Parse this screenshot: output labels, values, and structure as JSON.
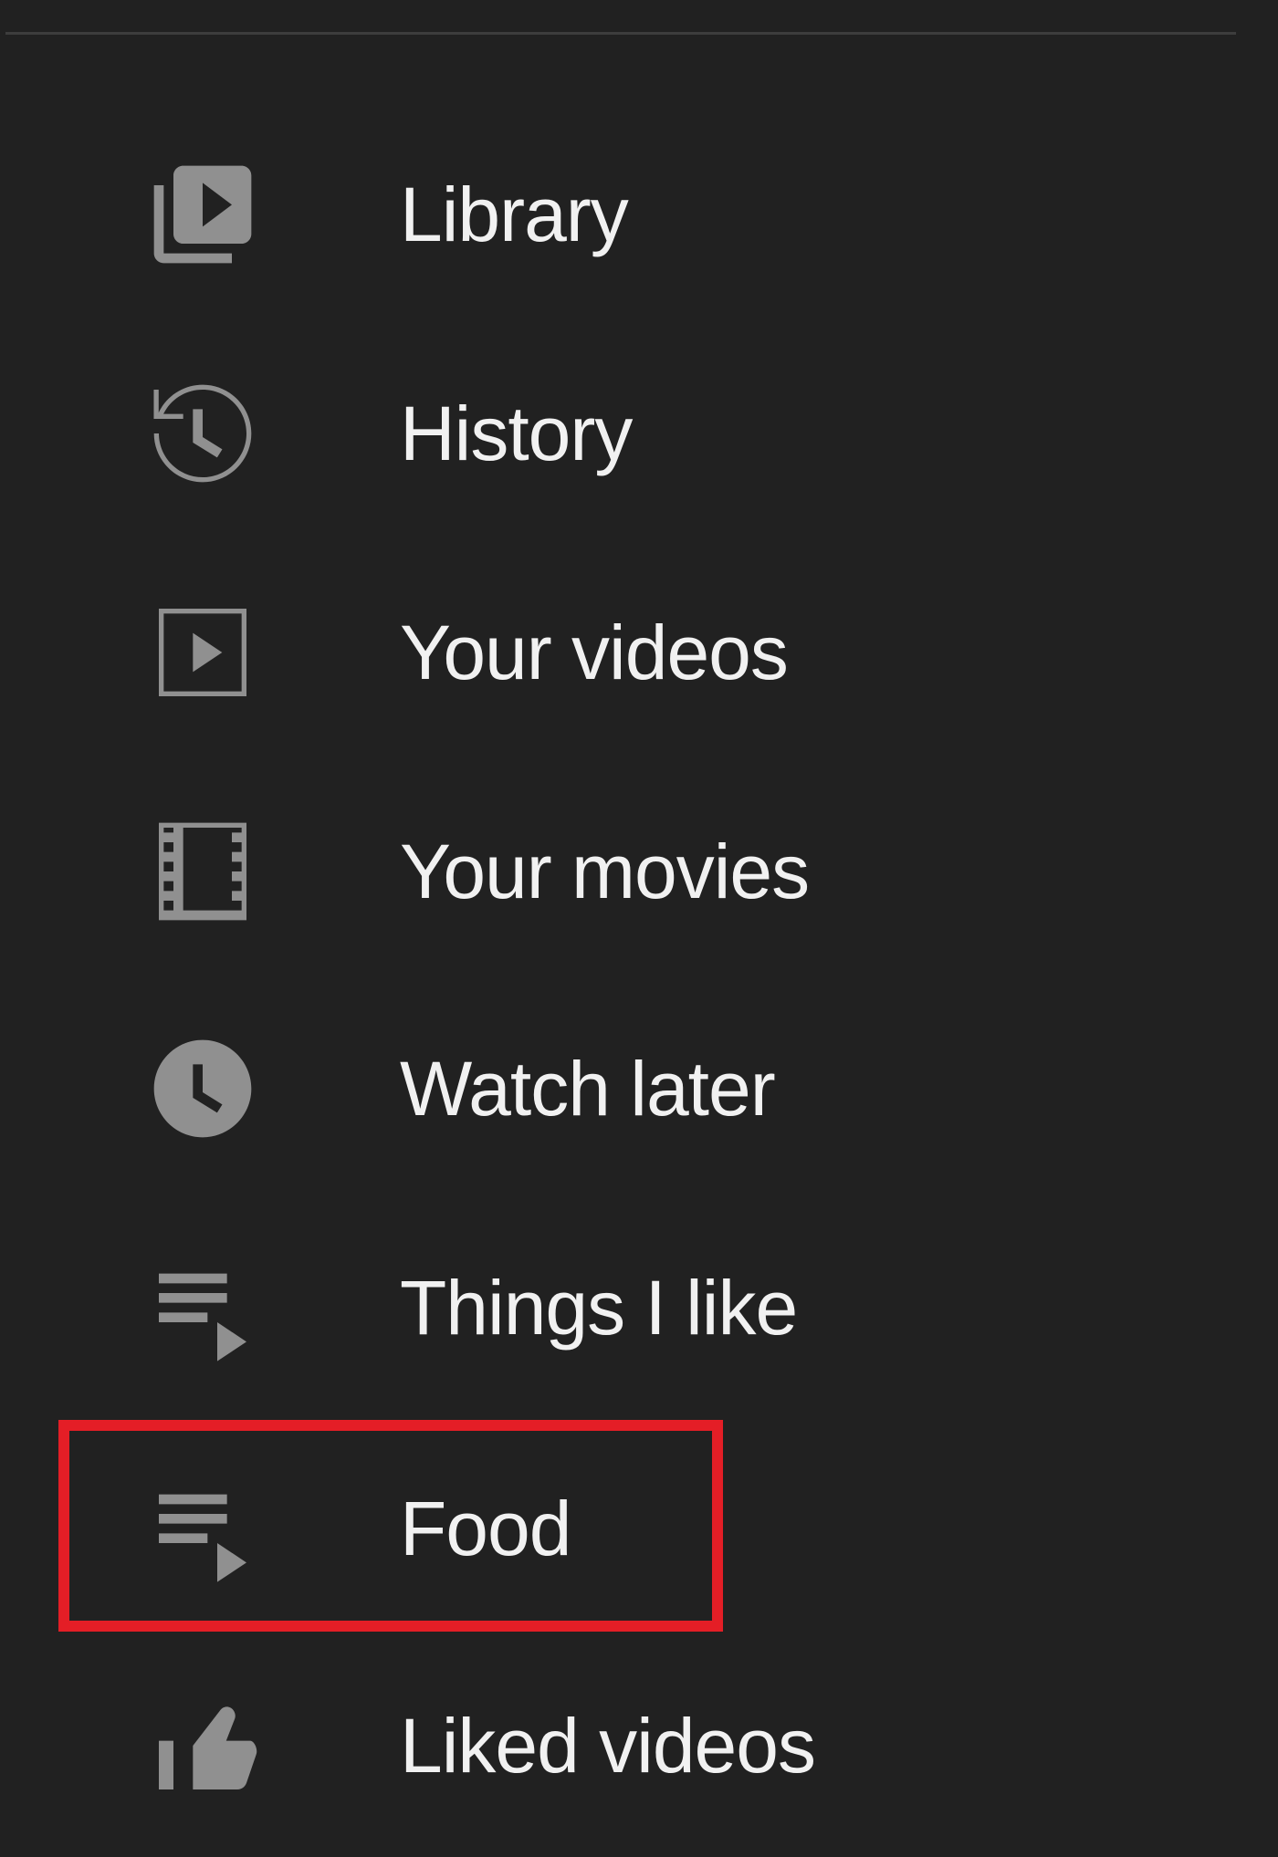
{
  "sidebar": {
    "items": [
      {
        "label": "Library",
        "icon": "library-icon"
      },
      {
        "label": "History",
        "icon": "history-icon"
      },
      {
        "label": "Your videos",
        "icon": "your-videos-icon"
      },
      {
        "label": "Your movies",
        "icon": "movies-icon"
      },
      {
        "label": "Watch later",
        "icon": "clock-icon"
      },
      {
        "label": "Things I like",
        "icon": "playlist-icon"
      },
      {
        "label": "Food",
        "icon": "playlist-icon",
        "highlighted": true
      },
      {
        "label": "Liked videos",
        "icon": "thumbs-up-icon"
      }
    ]
  },
  "colors": {
    "background": "#212121",
    "text": "#f1f1f1",
    "icon": "#909090",
    "highlight": "#e41e26"
  }
}
